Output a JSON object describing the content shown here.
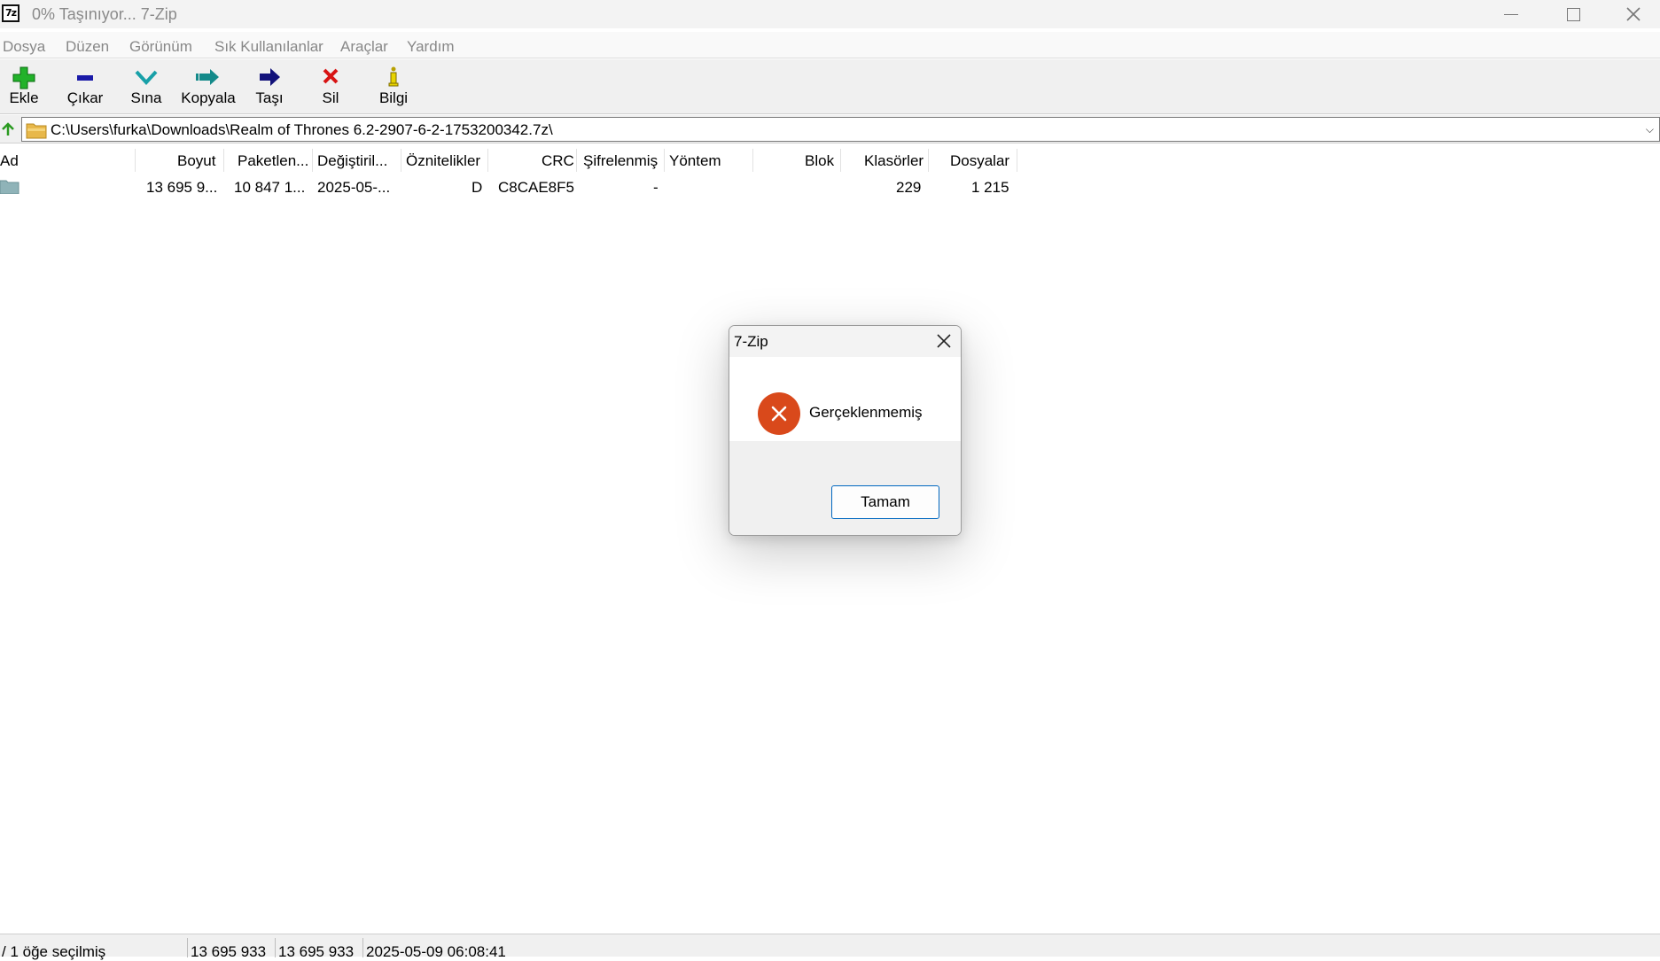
{
  "window": {
    "icon_text": "7z",
    "title": "0% Taşınıyor... 7-Zip"
  },
  "menu": [
    "Dosya",
    "Düzen",
    "Görünüm",
    "Sık Kullanılanlar",
    "Araçlar",
    "Yardım"
  ],
  "toolbar": {
    "add": "Ekle",
    "extract": "Çıkar",
    "test": "Sına",
    "copy": "Kopyala",
    "move": "Taşı",
    "delete": "Sil",
    "info": "Bilgi"
  },
  "address": {
    "path": "C:\\Users\\furka\\Downloads\\Realm of Thrones 6.2-2907-6-2-1753200342.7z\\"
  },
  "columns": [
    "Ad",
    "Boyut",
    "Paketlen...",
    "Değiştiril...",
    "Öznitelikler",
    "CRC",
    "Şifrelenmiş",
    "Yöntem",
    "Blok",
    "Klasörler",
    "Dosyalar"
  ],
  "rows": [
    {
      "name": "",
      "size": "13 695 9...",
      "packed": "10 847 1...",
      "modified": "2025-05-...",
      "attributes": "D",
      "crc": "C8CAE8F5",
      "encrypted": "-",
      "method": "",
      "block": "",
      "folders": "229",
      "files": "1 215"
    }
  ],
  "status": {
    "selection": "/ 1 öğe seçilmiş",
    "size": "13 695 933",
    "packed": "13 695 933",
    "modified": "2025-05-09 06:08:41"
  },
  "dialog": {
    "title": "7-Zip",
    "message": "Gerçeklenmemiş",
    "ok_label": "Tamam",
    "icon": "error-icon"
  },
  "colors": {
    "error": "#d9491b",
    "accent": "#0067c0"
  }
}
